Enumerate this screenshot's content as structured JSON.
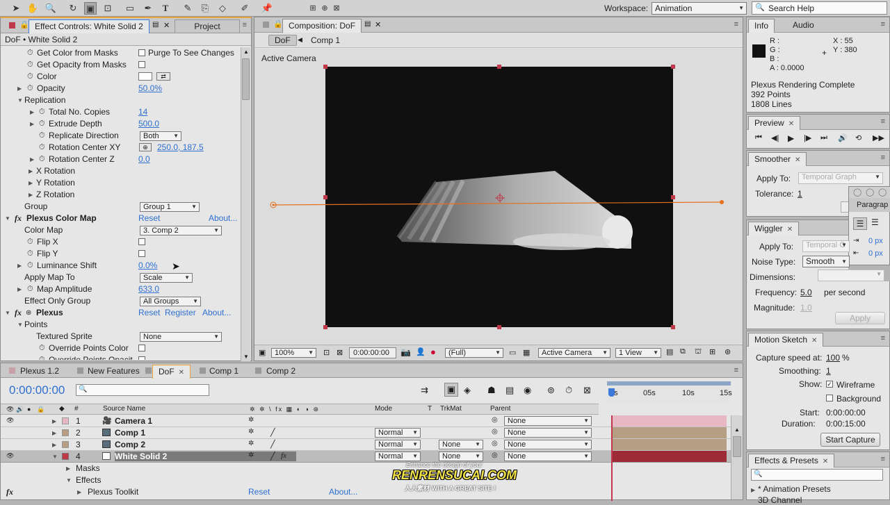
{
  "workspace": {
    "label": "Workspace:",
    "value": "Animation",
    "search_placeholder": "Search Help"
  },
  "effect_panel": {
    "tab": "Effect Controls: White Solid 2",
    "tab2": "Project",
    "subtitle": "DoF • White Solid 2",
    "rows": [
      {
        "label": "Get Color from Masks",
        "right_label": "Purge To See Changes"
      },
      {
        "label": "Get Opacity from Masks"
      },
      {
        "label": "Color"
      },
      {
        "label": "Opacity",
        "value": "50.0%"
      },
      {
        "label": "Replication"
      },
      {
        "label": "Total No. Copies",
        "value": "14"
      },
      {
        "label": "Extrude Depth",
        "value": "500.0"
      },
      {
        "label": "Replicate Direction",
        "value": "Both"
      },
      {
        "label": "Rotation Center XY",
        "value": "250.0, 187.5"
      },
      {
        "label": "Rotation Center Z",
        "value": "0.0"
      },
      {
        "label": "X Rotation"
      },
      {
        "label": "Y Rotation"
      },
      {
        "label": "Z Rotation"
      },
      {
        "label": "Group",
        "value": "Group 1"
      },
      {
        "label": "Plexus Color Map",
        "reset": "Reset",
        "about": "About..."
      },
      {
        "label": "Color Map",
        "value": "3. Comp 2"
      },
      {
        "label": "Flip X"
      },
      {
        "label": "Flip Y"
      },
      {
        "label": "Luminance Shift",
        "value": "0.0%"
      },
      {
        "label": "Apply Map To",
        "value": "Scale"
      },
      {
        "label": "Map Amplitude",
        "value": "633.0"
      },
      {
        "label": "Effect Only Group",
        "value": "All Groups"
      },
      {
        "label": "Plexus",
        "reset": "Reset",
        "register": "Register",
        "about": "About..."
      },
      {
        "label": "Points"
      },
      {
        "label": "Textured Sprite",
        "value": "None"
      },
      {
        "label": "Override Points Color"
      },
      {
        "label": "Override Points Opacit"
      }
    ]
  },
  "comp_panel": {
    "tab": "Composition: DoF",
    "crumb1": "DoF",
    "crumb2": "Comp 1",
    "active_camera": "Active Camera",
    "footer": {
      "zoom": "100%",
      "time": "0:00:00:00",
      "quality": "(Full)",
      "camera": "Active Camera",
      "views": "1 View"
    }
  },
  "info_panel": {
    "tab": "Info",
    "tab2": "Audio",
    "r": "R :",
    "g": "G :",
    "b": "B :",
    "a": "A : 0.0000",
    "x": "X : 55",
    "y": "Y : 380",
    "status": [
      "Plexus Rendering Complete",
      "392 Points",
      "1808 Lines"
    ]
  },
  "preview_panel": {
    "tab": "Preview"
  },
  "smoother_panel": {
    "tab": "Smoother",
    "apply_to_label": "Apply To:",
    "apply_to_value": "Temporal Graph",
    "tolerance_label": "Tolerance:",
    "tolerance_value": "1"
  },
  "paragraph_panel": {
    "tab": "Paragrap",
    "px1": "0 px",
    "px2": "0 px"
  },
  "wiggler_panel": {
    "tab": "Wiggler",
    "apply_to_label": "Apply To:",
    "apply_to_value": "Temporal G",
    "noise_label": "Noise Type:",
    "noise_value": "Smooth",
    "dimensions_label": "Dimensions:",
    "frequency_label": "Frequency:",
    "frequency_value": "5.0",
    "per_second": "per second",
    "magnitude_label": "Magnitude:",
    "magnitude_value": "1.0",
    "apply_button": "Apply"
  },
  "motion_sketch": {
    "tab": "Motion Sketch",
    "capture_label": "Capture speed at:",
    "capture_value": "100",
    "capture_unit": "%",
    "smoothing_label": "Smoothing:",
    "smoothing_value": "1",
    "show_label": "Show:",
    "wireframe": "Wireframe",
    "background": "Background",
    "start_label": "Start:",
    "start_value": "0:00:00:00",
    "duration_label": "Duration:",
    "duration_value": "0:00:15:00",
    "capture_button": "Start Capture"
  },
  "effects_presets": {
    "tab": "Effects & Presets",
    "item1": "* Animation Presets",
    "item2": "3D Channel"
  },
  "timeline": {
    "tabs": [
      "Plexus 1.2",
      "New Features",
      "DoF",
      "Comp 1",
      "Comp 2"
    ],
    "timecode": "0:00:00:00",
    "headers": {
      "num": "#",
      "source": "Source Name",
      "mode": "Mode",
      "t": "T",
      "trkmat": "TrkMat",
      "parent": "Parent"
    },
    "ruler": [
      "0s",
      "05s",
      "10s",
      "15s"
    ],
    "layers": [
      {
        "num": "1",
        "name": "Camera 1",
        "mode": "",
        "trkmat": "",
        "parent": "None",
        "color": "#e7b7c4"
      },
      {
        "num": "2",
        "name": "Comp 1",
        "mode": "Normal",
        "trkmat": "",
        "parent": "None",
        "color": "#b59e82"
      },
      {
        "num": "3",
        "name": "Comp 2",
        "mode": "Normal",
        "trkmat": "None",
        "parent": "None",
        "color": "#b59e82"
      },
      {
        "num": "4",
        "name": "White Solid 2",
        "mode": "Normal",
        "trkmat": "None",
        "parent": "None",
        "color": "#9c2b35"
      }
    ],
    "sub": {
      "masks": "Masks",
      "effects": "Effects",
      "plexus_toolkit": "Plexus Toolkit",
      "reset": "Reset",
      "about": "About..."
    }
  },
  "watermark": {
    "line1": "Enhance the design of your",
    "line2": "RENRENSUCAI.COM",
    "line3": "人人素材 WITH A GREAT SITE !"
  }
}
